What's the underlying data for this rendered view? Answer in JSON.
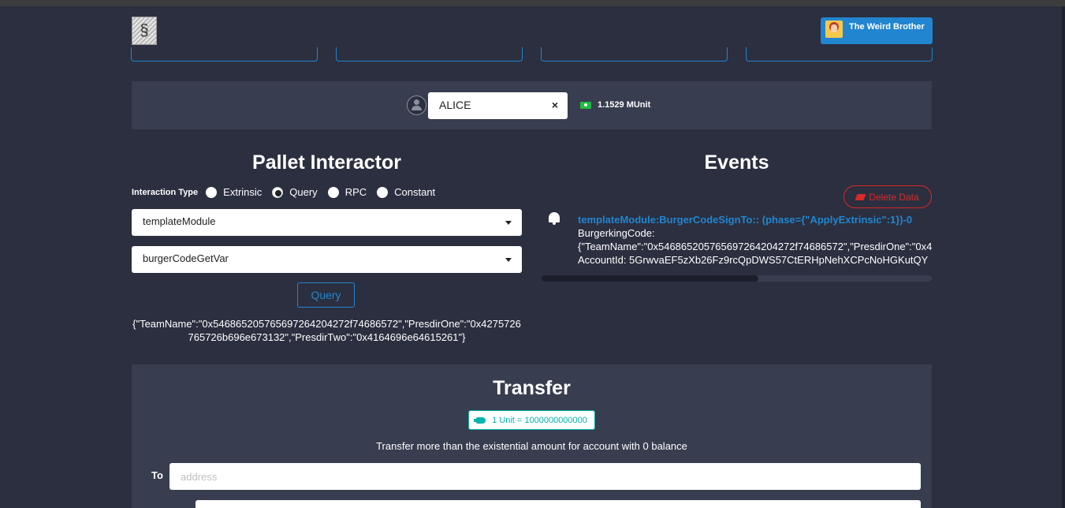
{
  "header": {
    "account_name": "The Weird Brother"
  },
  "account_selector": {
    "selected": "ALICE",
    "clear_symbol": "×",
    "balance": "1.1529 MUnit"
  },
  "pallet": {
    "title": "Pallet Interactor",
    "interaction_label": "Interaction Type",
    "options": [
      "Extrinsic",
      "Query",
      "RPC",
      "Constant"
    ],
    "selected_option": "Query",
    "module": "templateModule",
    "callable": "burgerCodeGetVar",
    "query_button": "Query",
    "result": "{\"TeamName\":\"0x546865205765697264204272f74686572\",\"PresdirOne\":\"0x4275726765726b696e673132\",\"PresdirTwo\":\"0x4164696e64615261\"}"
  },
  "events": {
    "title": "Events",
    "delete_button": "Delete Data",
    "items": [
      {
        "title": "templateModule:BurgerCodeSignTo:: (phase={\"ApplyExtrinsic\":1})-0",
        "lines": [
          "BurgerkingCode:",
          "{\"TeamName\":\"0x546865205765697264204272f74686572\",\"PresdirOne\":\"0x4",
          "AccountId: 5GrwvaEF5zXb26Fz9rcQpDWS57CtERHpNehXCPcNoHGKutQY"
        ]
      }
    ]
  },
  "transfer": {
    "title": "Transfer",
    "unit_badge": "1 Unit = 1000000000000",
    "note": "Transfer more than the existential amount for account with 0 balance",
    "to_label": "To",
    "to_placeholder": "address"
  },
  "colors": {
    "background": "#2b2f3f",
    "panel": "#383d50",
    "primary": "#2185d0",
    "danger": "#db2828",
    "teal": "#00b5ad",
    "success": "#21ba45"
  },
  "icons": [
    "logo",
    "avatar",
    "user-icon",
    "close-icon",
    "money-icon",
    "chevron-down-icon",
    "bell-icon",
    "eraser-icon",
    "hand-point-right-icon"
  ]
}
